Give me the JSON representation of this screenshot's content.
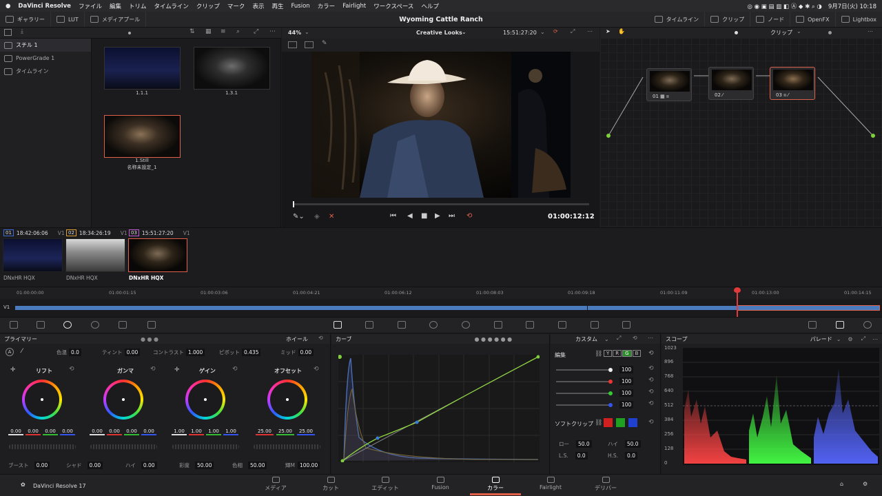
{
  "menubar": {
    "app": "DaVinci Resolve",
    "items": [
      "ファイル",
      "編集",
      "トリム",
      "タイムライン",
      "クリップ",
      "マーク",
      "表示",
      "再生",
      "Fusion",
      "カラー",
      "Fairlight",
      "ワークスペース",
      "ヘルプ"
    ],
    "clock": "9月7日(火) 10:18"
  },
  "topbar": {
    "gallery": "ギャラリー",
    "lut": "LUT",
    "media_pool": "メディアプール",
    "project_title": "Wyoming Cattle Ranch",
    "timeline": "タイムライン",
    "clip": "クリップ",
    "node": "ノード",
    "openfx": "OpenFX",
    "lightbox": "Lightbox"
  },
  "gallery": {
    "albums": [
      "スチル 1",
      "PowerGrade 1",
      "タイムライン"
    ],
    "stills": [
      {
        "label": "1.1.1",
        "sub": ""
      },
      {
        "label": "1.3.1",
        "sub": ""
      },
      {
        "label": "1.Still",
        "sub": "名称未設定_1"
      }
    ]
  },
  "viewer": {
    "zoom": "44%",
    "look": "Creative Looks",
    "timecode_top": "15:51:27:20",
    "timecode": "01:00:12:12"
  },
  "nodes": {
    "header": "クリップ",
    "items": [
      "01",
      "02",
      "03"
    ]
  },
  "clips": [
    {
      "num": "01",
      "tc": "18:42:06:06",
      "track": "V1",
      "codec": "DNxHR HQX"
    },
    {
      "num": "02",
      "tc": "18:34:26:19",
      "track": "V1",
      "codec": "DNxHR HQX"
    },
    {
      "num": "03",
      "tc": "15:51:27:20",
      "track": "V1",
      "codec": "DNxHR HQX"
    }
  ],
  "ruler": [
    "01:00:00:00",
    "01:00:01:15",
    "01:00:03:06",
    "01:00:04:21",
    "01:00:06:12",
    "01:00:08:03",
    "01:00:09:18",
    "01:00:11:09",
    "01:00:13:00",
    "01:00:14:15"
  ],
  "track_label": "V1",
  "primaries": {
    "title": "プライマリー",
    "mode": "ホイール",
    "temp_label": "色温",
    "temp": "0.0",
    "tint_label": "ティント",
    "tint": "0.00",
    "contrast_label": "コントラスト",
    "contrast": "1.000",
    "pivot_label": "ピボット",
    "pivot": "0.435",
    "mid_label": "ミッド",
    "mid": "0.00",
    "wheels": [
      {
        "name": "リフト",
        "values": [
          "0.00",
          "0.00",
          "0.00",
          "0.00"
        ]
      },
      {
        "name": "ガンマ",
        "values": [
          "0.00",
          "0.00",
          "0.00",
          "0.00"
        ]
      },
      {
        "name": "ゲイン",
        "values": [
          "1.00",
          "1.00",
          "1.00",
          "1.00"
        ]
      },
      {
        "name": "オフセット",
        "values": [
          "25.00",
          "25.00",
          "25.00"
        ]
      }
    ],
    "boost_label": "ブースト",
    "boost": "0.00",
    "shadow_label": "シャド",
    "shadow": "0.00",
    "high_label": "ハイ",
    "high": "0.00",
    "sat_label": "彩度",
    "sat": "50.00",
    "hue_label": "色相",
    "hue": "50.00",
    "lummix_label": "輝M",
    "lummix": "100.00"
  },
  "curves": {
    "title": "カーブ"
  },
  "custom": {
    "title": "カスタム",
    "edit_label": "編集",
    "channels": [
      "Y",
      "R",
      "G",
      "B"
    ],
    "values": [
      "100",
      "100",
      "100",
      "100"
    ],
    "softclip_label": "ソフトクリップ",
    "low_label": "ロー",
    "low": "50.0",
    "high_label": "ハイ",
    "high": "50.0",
    "ls_label": "L.S.",
    "ls": "0.0",
    "hs_label": "H.S.",
    "hs": "0.0"
  },
  "scopes": {
    "title": "スコープ",
    "mode": "パレード",
    "ticks": [
      "1023",
      "896",
      "768",
      "640",
      "512",
      "384",
      "256",
      "128",
      "0"
    ]
  },
  "bottomnav": {
    "product": "DaVinci Resolve 17",
    "pages": [
      "メディア",
      "カット",
      "エディット",
      "Fusion",
      "カラー",
      "Fairlight",
      "デリバー"
    ],
    "active": "カラー"
  },
  "colors": {
    "accent": "#e0604a",
    "playhead": "#e23a3a",
    "track": "#4a7bbf"
  }
}
